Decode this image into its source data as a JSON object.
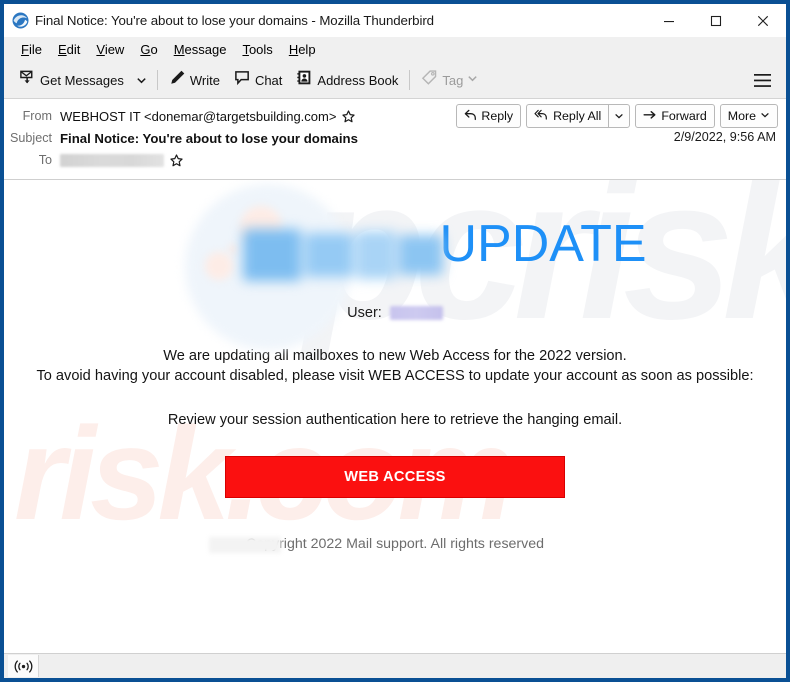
{
  "window": {
    "title": "Final Notice: You're about to lose your domains - Mozilla Thunderbird",
    "app_icon": "thunderbird-icon",
    "controls": {
      "minimize": "minimize-icon",
      "maximize": "maximize-icon",
      "close": "close-icon"
    }
  },
  "menu_bar": {
    "items": [
      {
        "label": "File",
        "accesskey": "F"
      },
      {
        "label": "Edit",
        "accesskey": "E"
      },
      {
        "label": "View",
        "accesskey": "V"
      },
      {
        "label": "Go",
        "accesskey": "G"
      },
      {
        "label": "Message",
        "accesskey": "M"
      },
      {
        "label": "Tools",
        "accesskey": "T"
      },
      {
        "label": "Help",
        "accesskey": "H"
      }
    ]
  },
  "toolbar": {
    "get_messages": "Get Messages",
    "write": "Write",
    "chat": "Chat",
    "address_book": "Address Book",
    "tag": "Tag",
    "app_menu": "app-menu-icon"
  },
  "message_header": {
    "from_label": "From",
    "from_value": "WEBHOST IT <donemar@targetsbuilding.com>",
    "subject_label": "Subject",
    "subject_value": "Final Notice: You're about to lose your domains",
    "to_label": "To",
    "to_value": "",
    "date": "2/9/2022, 9:56 AM",
    "actions": {
      "reply": "Reply",
      "reply_all": "Reply All",
      "forward": "Forward",
      "more": "More"
    }
  },
  "email": {
    "heading_word": "UPDATE",
    "user_label": "User:",
    "user_value": "",
    "paragraph_1_line_1": "We are updating all mailboxes to new Web Access for the 2022 version.",
    "paragraph_1_line_2": "To avoid having your account disabled, please visit WEB ACCESS to update your account as soon as possible:",
    "paragraph_2": "Review your session authentication here to retrieve the hanging email.",
    "cta_label": "WEB ACCESS",
    "footer": "Copyright 2022 Mail support. All rights reserved",
    "watermark_top": "pcrisk",
    "watermark_bottom": "risk.com",
    "colors": {
      "heading_blue": "#1e90f7",
      "cta_red": "#fb1010",
      "cta_text": "#ffffff",
      "footer_gray": "#6d6d6d"
    }
  },
  "status_bar": {
    "online_icon": "online-status-icon",
    "text": ""
  }
}
